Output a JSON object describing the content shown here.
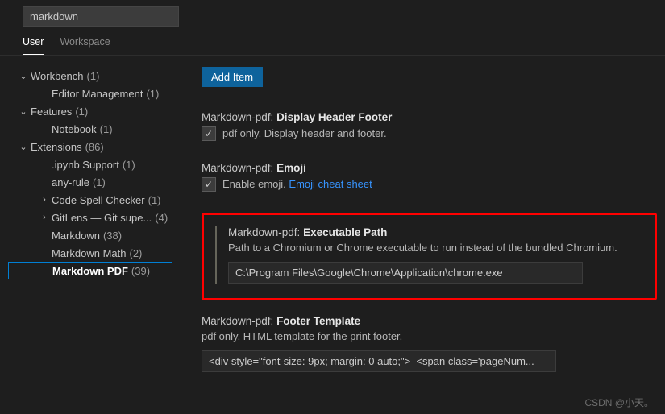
{
  "search": {
    "value": "markdown"
  },
  "tabs": {
    "user": "User",
    "workspace": "Workspace"
  },
  "sidebar": [
    {
      "label": "Workbench",
      "count": "(1)",
      "level": 0,
      "arrow": "down"
    },
    {
      "label": "Editor Management",
      "count": "(1)",
      "level": 1
    },
    {
      "label": "Features",
      "count": "(1)",
      "level": 0,
      "arrow": "down"
    },
    {
      "label": "Notebook",
      "count": "(1)",
      "level": 1
    },
    {
      "label": "Extensions",
      "count": "(86)",
      "level": 0,
      "arrow": "down"
    },
    {
      "label": ".ipynb Support",
      "count": "(1)",
      "level": 1
    },
    {
      "label": "any-rule",
      "count": "(1)",
      "level": 1
    },
    {
      "label": "Code Spell Checker",
      "count": "(1)",
      "level": 1,
      "arrow": "right"
    },
    {
      "label": "GitLens — Git supe...",
      "count": "(4)",
      "level": 1,
      "arrow": "right"
    },
    {
      "label": "Markdown",
      "count": "(38)",
      "level": 1
    },
    {
      "label": "Markdown Math",
      "count": "(2)",
      "level": 1
    },
    {
      "label": "Markdown PDF",
      "count": "(39)",
      "level": 1,
      "selected": true
    }
  ],
  "addItem": "Add Item",
  "settings": {
    "displayHeaderFooter": {
      "prefix": "Markdown-pdf:",
      "name": "Display Header Footer",
      "desc": "pdf only. Display header and footer."
    },
    "emoji": {
      "prefix": "Markdown-pdf:",
      "name": "Emoji",
      "desc": "Enable emoji.",
      "link": "Emoji cheat sheet"
    },
    "executablePath": {
      "prefix": "Markdown-pdf:",
      "name": "Executable Path",
      "desc": "Path to a Chromium or Chrome executable to run instead of the bundled Chromium.",
      "value": "C:\\Program Files\\Google\\Chrome\\Application\\chrome.exe"
    },
    "footerTemplate": {
      "prefix": "Markdown-pdf:",
      "name": "Footer Template",
      "desc": "pdf only. HTML template for the print footer.",
      "value": "<div style=\"font-size: 9px; margin: 0 auto;\">  <span class='pageNum..."
    }
  },
  "watermark": "CSDN @小天。"
}
